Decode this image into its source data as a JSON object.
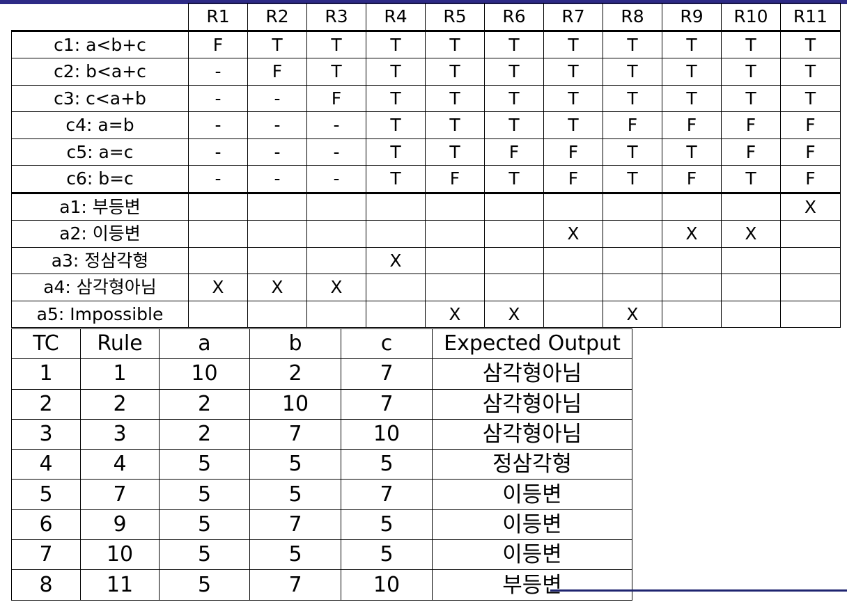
{
  "decision_table": {
    "rule_headers": [
      "R1",
      "R2",
      "R3",
      "R4",
      "R5",
      "R6",
      "R7",
      "R8",
      "R9",
      "R10",
      "R11"
    ],
    "conditions": [
      {
        "label": "c1: a<b+c",
        "values": [
          "F",
          "T",
          "T",
          "T",
          "T",
          "T",
          "T",
          "T",
          "T",
          "T",
          "T"
        ]
      },
      {
        "label": "c2: b<a+c",
        "values": [
          "-",
          "F",
          "T",
          "T",
          "T",
          "T",
          "T",
          "T",
          "T",
          "T",
          "T"
        ]
      },
      {
        "label": "c3: c<a+b",
        "values": [
          "-",
          "-",
          "F",
          "T",
          "T",
          "T",
          "T",
          "T",
          "T",
          "T",
          "T"
        ]
      },
      {
        "label": "c4: a=b",
        "values": [
          "-",
          "-",
          "-",
          "T",
          "T",
          "T",
          "T",
          "F",
          "F",
          "F",
          "F"
        ]
      },
      {
        "label": "c5: a=c",
        "values": [
          "-",
          "-",
          "-",
          "T",
          "T",
          "F",
          "F",
          "T",
          "T",
          "F",
          "F"
        ]
      },
      {
        "label": "c6: b=c",
        "values": [
          "-",
          "-",
          "-",
          "T",
          "F",
          "T",
          "F",
          "T",
          "F",
          "T",
          "F"
        ]
      }
    ],
    "actions": [
      {
        "label": "a1: 부등변",
        "values": [
          "",
          "",
          "",
          "",
          "",
          "",
          "",
          "",
          "",
          "",
          "X"
        ]
      },
      {
        "label": "a2: 이등변",
        "values": [
          "",
          "",
          "",
          "",
          "",
          "",
          "X",
          "",
          "X",
          "X",
          ""
        ]
      },
      {
        "label": "a3: 정삼각형",
        "values": [
          "",
          "",
          "",
          "X",
          "",
          "",
          "",
          "",
          "",
          "",
          ""
        ]
      },
      {
        "label": "a4: 삼각형아님",
        "values": [
          "X",
          "X",
          "X",
          "",
          "",
          "",
          "",
          "",
          "",
          "",
          ""
        ]
      },
      {
        "label": "a5: Impossible",
        "values": [
          "",
          "",
          "",
          "",
          "X",
          "X",
          "",
          "X",
          "",
          "",
          ""
        ]
      }
    ]
  },
  "test_cases": {
    "headers": [
      "TC",
      "Rule",
      "a",
      "b",
      "c",
      "Expected Output"
    ],
    "rows": [
      [
        "1",
        "1",
        "10",
        "2",
        "7",
        "삼각형아님"
      ],
      [
        "2",
        "2",
        "2",
        "10",
        "7",
        "삼각형아님"
      ],
      [
        "3",
        "3",
        "2",
        "7",
        "10",
        "삼각형아님"
      ],
      [
        "4",
        "4",
        "5",
        "5",
        "5",
        "정삼각형"
      ],
      [
        "5",
        "7",
        "5",
        "5",
        "7",
        "이등변"
      ],
      [
        "6",
        "9",
        "5",
        "7",
        "5",
        "이등변"
      ],
      [
        "7",
        "10",
        "5",
        "5",
        "5",
        "이등변"
      ],
      [
        "8",
        "11",
        "5",
        "7",
        "10",
        "부등변"
      ]
    ]
  },
  "colors": {
    "top_bar": "#2d2a86",
    "bottom_rule": "#1e2470"
  }
}
